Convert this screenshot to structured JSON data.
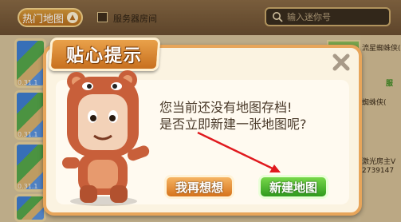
{
  "topbar": {
    "hot_map_label": "热门地图",
    "server_room_label": "服务器房间",
    "search_placeholder": "输入迷你号"
  },
  "map_cards": [
    {
      "version": "0.31.1"
    },
    {
      "version": "0.31.1"
    },
    {
      "version": "0.31.1"
    },
    {
      "version": "0.31.1"
    }
  ],
  "right_list": {
    "item1_title": "流星蜘蛛侠(",
    "item2_title": "蜘蛛侠(",
    "item3_title": "激光房主V",
    "item3_id": "2739147",
    "badge": "服"
  },
  "dialog": {
    "title": "贴心提示",
    "message_line1": "您当前还没有地图存档!",
    "message_line2": "是否立即新建一张地图呢?",
    "think_button": "我再想想",
    "new_map_button": "新建地图"
  },
  "colors": {
    "accent_orange": "#e7a55a",
    "confirm_green": "#2f9a1e",
    "arrow_red": "#e0191e"
  }
}
